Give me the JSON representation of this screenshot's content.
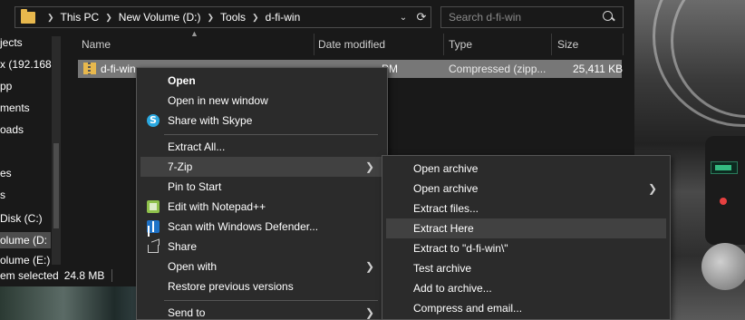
{
  "address": {
    "breadcrumb": [
      "This PC",
      "New Volume (D:)",
      "Tools",
      "d-fi-win"
    ],
    "dropdown_glyph": "⌄",
    "refresh_glyph": "⟳"
  },
  "search": {
    "placeholder": "Search d-fi-win"
  },
  "nav": {
    "items": [
      "jects",
      "x (192.168",
      "pp",
      "ments",
      "oads",
      "es",
      "s",
      "Disk (C:)",
      "olume (D:",
      "olume (E:)"
    ]
  },
  "columns": {
    "name": "Name",
    "date_modified": "Date modified",
    "type": "Type",
    "size": "Size"
  },
  "file": {
    "name": "d-fi-win",
    "date_tail": "PM",
    "type": "Compressed (zipp...",
    "size": "25,411 KB"
  },
  "status": {
    "selected": "em selected",
    "size": "24.8 MB"
  },
  "context_menu": {
    "items": [
      {
        "label": "Open",
        "bold": true
      },
      {
        "label": "Open in new window"
      },
      {
        "label": "Share with Skype",
        "icon": "skype-icon"
      },
      {
        "label": "Extract All..."
      },
      {
        "label": "7-Zip",
        "submenu": true
      },
      {
        "label": "Pin to Start"
      },
      {
        "label": "Edit with Notepad++",
        "icon": "notepad-plus-plus-icon"
      },
      {
        "label": "Scan with Windows Defender...",
        "icon": "windows-defender-icon"
      },
      {
        "label": "Share",
        "icon": "share-icon"
      },
      {
        "label": "Open with",
        "submenu": true
      },
      {
        "label": "Restore previous versions"
      },
      {
        "label": "Send to",
        "submenu": true
      }
    ]
  },
  "submenu_7zip": {
    "items": [
      {
        "label": "Open archive"
      },
      {
        "label": "Open archive",
        "submenu": true
      },
      {
        "label": "Extract files..."
      },
      {
        "label": "Extract Here"
      },
      {
        "label": "Extract to \"d-fi-win\\\""
      },
      {
        "label": "Test archive"
      },
      {
        "label": "Add to archive..."
      },
      {
        "label": "Compress and email..."
      }
    ]
  },
  "colors": {
    "background": "#191919",
    "menu_background": "#2b2b2b",
    "menu_hover": "#414141",
    "selection": "#777777",
    "folder_yellow": "#e8b84d"
  }
}
